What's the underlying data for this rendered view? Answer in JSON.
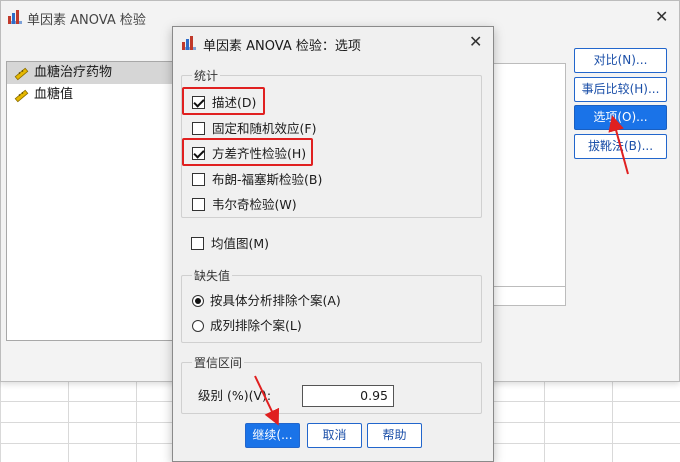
{
  "main": {
    "title": "单因素 ANOVA 检验",
    "close": "✕",
    "variables": [
      {
        "label": "血糖治疗药物",
        "selected": true
      },
      {
        "label": "血糖值",
        "selected": false
      }
    ],
    "side_buttons": [
      {
        "label": "对比(N)..."
      },
      {
        "label": "事后比较(H)..."
      },
      {
        "label": "选项(O)..."
      },
      {
        "label": "拔靴法(B)..."
      }
    ]
  },
  "options": {
    "title": "单因素 ANOVA 检验：选项",
    "close": "✕",
    "stats_group": "统计",
    "stats": [
      {
        "label": "描述(D)",
        "checked": true
      },
      {
        "label": "固定和随机效应(F)",
        "checked": false
      },
      {
        "label": "方差齐性检验(H)",
        "checked": true
      },
      {
        "label": "布朗-福塞斯检验(B)",
        "checked": false
      },
      {
        "label": "韦尔奇检验(W)",
        "checked": false
      }
    ],
    "means_plot": {
      "label": "均值图(M)",
      "checked": false
    },
    "missing_group": "缺失值",
    "missing": [
      {
        "label": "按具体分析排除个案(A)",
        "selected": true
      },
      {
        "label": "成列排除个案(L)",
        "selected": false
      }
    ],
    "ci_group": "置信区间",
    "ci_label": "级别 (%)(V):",
    "ci_value": "0.95",
    "buttons": {
      "continue": "继续(...",
      "cancel": "取消",
      "help": "帮助"
    }
  },
  "colors": {
    "accent": "#1a73e8",
    "highlight": "#e02020"
  }
}
